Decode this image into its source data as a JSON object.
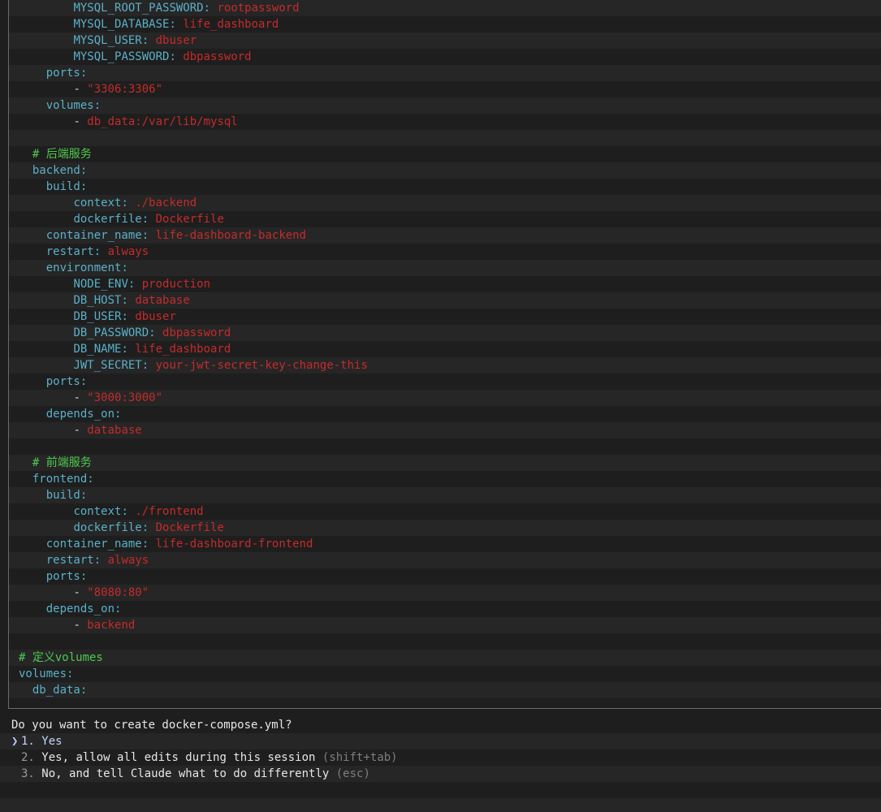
{
  "code_lines": [
    {
      "indent": "    ",
      "key": "MYSQL_ROOT_PASSWORD",
      "val": "rootpassword"
    },
    {
      "indent": "    ",
      "key": "MYSQL_DATABASE",
      "val": "life_dashboard"
    },
    {
      "indent": "    ",
      "key": "MYSQL_USER",
      "val": "dbuser"
    },
    {
      "indent": "    ",
      "key": "MYSQL_PASSWORD",
      "val": "dbpassword"
    },
    {
      "indent": "  ",
      "key": "ports"
    },
    {
      "indent": "    ",
      "dash": true,
      "val": "\"3306:3306\""
    },
    {
      "indent": "  ",
      "key": "volumes"
    },
    {
      "indent": "    ",
      "dash": true,
      "val": "db_data:/var/lib/mysql"
    },
    {
      "indent": ""
    },
    {
      "indent": " ",
      "comment": "# 后端服务"
    },
    {
      "indent": " ",
      "key": "backend"
    },
    {
      "indent": "  ",
      "key": "build"
    },
    {
      "indent": "    ",
      "key": "context",
      "val": "./backend"
    },
    {
      "indent": "    ",
      "key": "dockerfile",
      "val": "Dockerfile"
    },
    {
      "indent": "  ",
      "key": "container_name",
      "val": "life-dashboard-backend"
    },
    {
      "indent": "  ",
      "key": "restart",
      "val": "always"
    },
    {
      "indent": "  ",
      "key": "environment"
    },
    {
      "indent": "    ",
      "key": "NODE_ENV",
      "val": "production"
    },
    {
      "indent": "    ",
      "key": "DB_HOST",
      "val": "database"
    },
    {
      "indent": "    ",
      "key": "DB_USER",
      "val": "dbuser"
    },
    {
      "indent": "    ",
      "key": "DB_PASSWORD",
      "val": "dbpassword"
    },
    {
      "indent": "    ",
      "key": "DB_NAME",
      "val": "life_dashboard"
    },
    {
      "indent": "    ",
      "key": "JWT_SECRET",
      "val": "your-jwt-secret-key-change-this"
    },
    {
      "indent": "  ",
      "key": "ports"
    },
    {
      "indent": "    ",
      "dash": true,
      "val": "\"3000:3000\""
    },
    {
      "indent": "  ",
      "key": "depends_on"
    },
    {
      "indent": "    ",
      "dash": true,
      "val": "database"
    },
    {
      "indent": ""
    },
    {
      "indent": " ",
      "comment": "# 前端服务"
    },
    {
      "indent": " ",
      "key": "frontend"
    },
    {
      "indent": "  ",
      "key": "build"
    },
    {
      "indent": "    ",
      "key": "context",
      "val": "./frontend"
    },
    {
      "indent": "    ",
      "key": "dockerfile",
      "val": "Dockerfile"
    },
    {
      "indent": "  ",
      "key": "container_name",
      "val": "life-dashboard-frontend"
    },
    {
      "indent": "  ",
      "key": "restart",
      "val": "always"
    },
    {
      "indent": "  ",
      "key": "ports"
    },
    {
      "indent": "    ",
      "dash": true,
      "val": "\"8080:80\""
    },
    {
      "indent": "  ",
      "key": "depends_on"
    },
    {
      "indent": "    ",
      "dash": true,
      "val": "backend"
    },
    {
      "indent": ""
    },
    {
      "indent": "",
      "comment": "# 定义volumes"
    },
    {
      "indent": "",
      "key": "volumes"
    },
    {
      "indent": " ",
      "key": "db_data"
    }
  ],
  "prompt": {
    "question": "Do you want to create docker-compose.yml?",
    "options": [
      {
        "num": "1.",
        "label": "Yes",
        "hint": "",
        "selected": true
      },
      {
        "num": "2.",
        "label": "Yes, allow all edits during this session",
        "hint": "(shift+tab)",
        "selected": false
      },
      {
        "num": "3.",
        "label": "No, and tell Claude what to do differently",
        "hint": "(esc)",
        "selected": false
      }
    ],
    "cursor_glyph": "❯"
  },
  "colors": {
    "background": "#1e1e1e",
    "stripe": "#262626",
    "key": "#5ab0c8",
    "value": "#c42b2b",
    "comment": "#4ec94e",
    "hint": "#7e7e7e"
  }
}
